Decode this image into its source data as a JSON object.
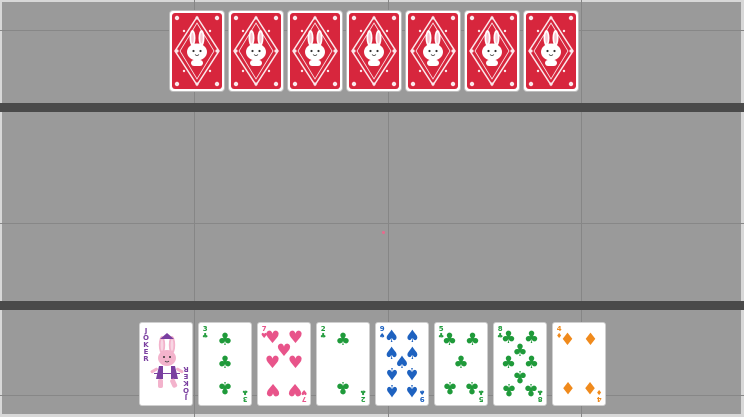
{
  "colors": {
    "table": "#9a9a9a",
    "band": "#4a4a4a",
    "card_back": "#d7263d",
    "hearts": "#e8548a",
    "clubs": "#1f9a3a",
    "spades": "#1e62c0",
    "diamonds": "#f08a1c",
    "joker": "#7a3fa0"
  },
  "opponent": {
    "card_back_icon": "bunny-card-back-icon",
    "hand_count": 7
  },
  "player": {
    "hand": [
      {
        "rank": "JOKER",
        "suit": "joker",
        "symbol": "",
        "color": "#7a3fa0"
      },
      {
        "rank": "3",
        "suit": "clubs",
        "symbol": "♣",
        "color": "#1f9a3a"
      },
      {
        "rank": "7",
        "suit": "hearts",
        "symbol": "♥",
        "color": "#e8548a"
      },
      {
        "rank": "2",
        "suit": "clubs",
        "symbol": "♣",
        "color": "#1f9a3a"
      },
      {
        "rank": "9",
        "suit": "spades",
        "symbol": "♠",
        "color": "#1e62c0"
      },
      {
        "rank": "5",
        "suit": "clubs",
        "symbol": "♣",
        "color": "#1f9a3a"
      },
      {
        "rank": "8",
        "suit": "clubs",
        "symbol": "♣",
        "color": "#1f9a3a"
      },
      {
        "rank": "4",
        "suit": "diamonds",
        "symbol": "♦",
        "color": "#f08a1c"
      }
    ]
  }
}
